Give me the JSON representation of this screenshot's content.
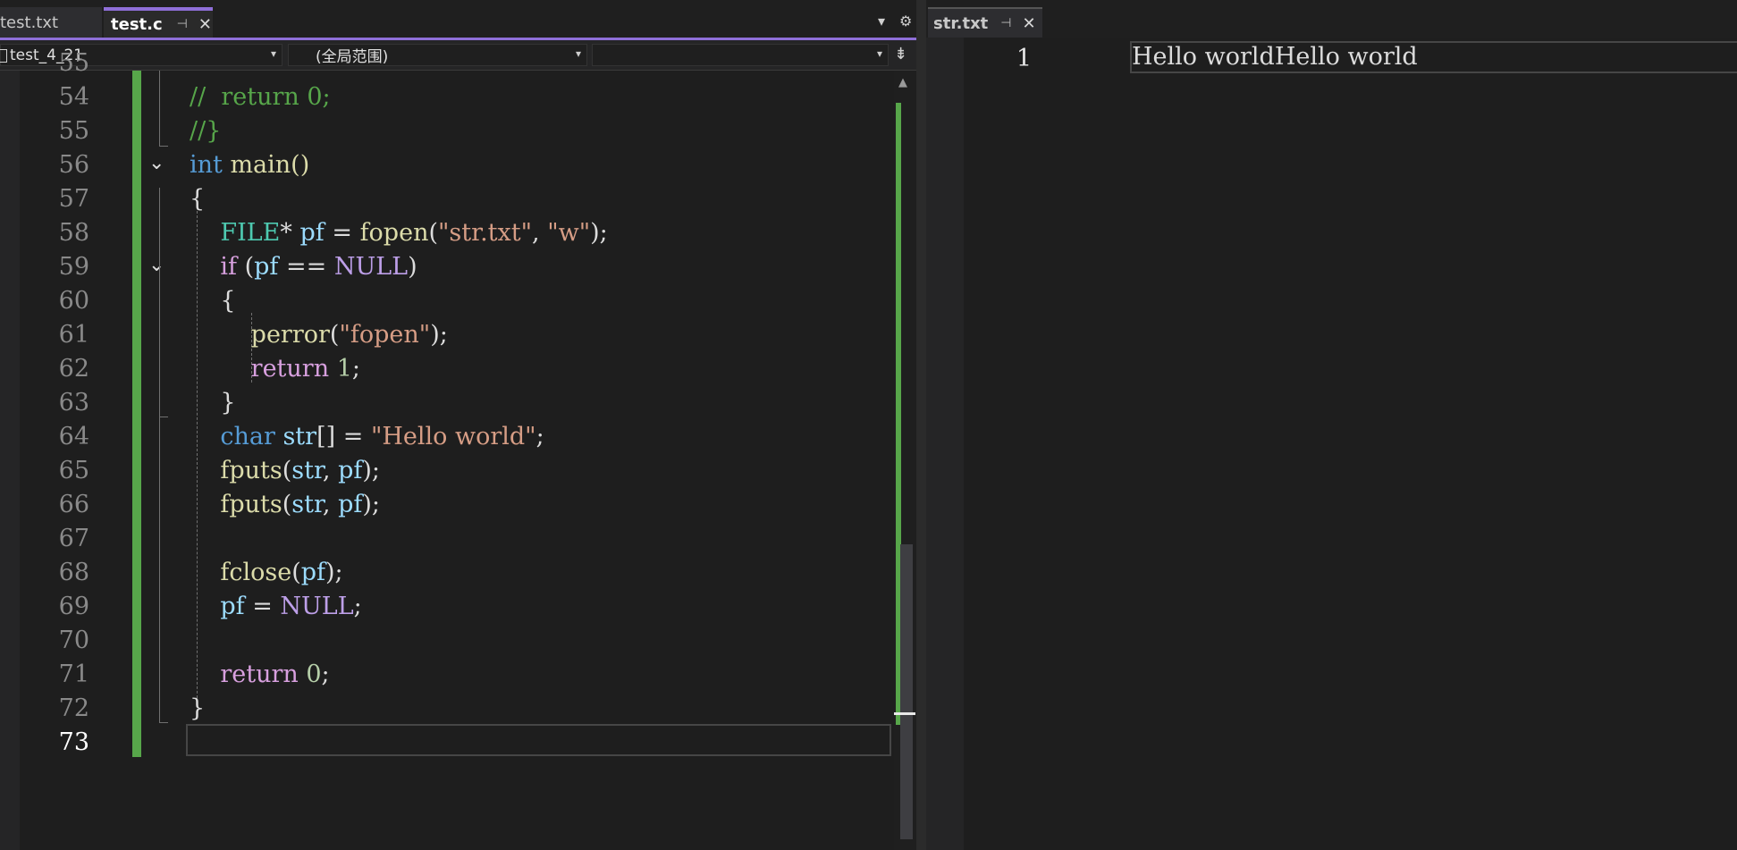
{
  "left_editor": {
    "tabs": [
      {
        "label": "test.txt",
        "active": false
      },
      {
        "label": "test.c",
        "active": true
      }
    ],
    "tab_pin_glyph": "⊣",
    "tab_close_glyph": "✕",
    "nav": {
      "project": "test_4_21",
      "scope": "(全局范围)",
      "member": ""
    },
    "partial_top_line": "55",
    "line_numbers": [
      "54",
      "55",
      "56",
      "57",
      "58",
      "59",
      "60",
      "61",
      "62",
      "63",
      "64",
      "65",
      "66",
      "67",
      "68",
      "69",
      "70",
      "71",
      "72",
      "73"
    ],
    "current_line": "73"
  },
  "right_editor": {
    "tab": {
      "label": "str.txt"
    },
    "line_number": "1",
    "content": "Hello worldHello world"
  },
  "colors": {
    "accent": "#8f6fd8",
    "change_bar": "#57a64a",
    "comment": "#57a64a",
    "keyword": "#569cd6",
    "control": "#d8a0df",
    "function": "#dcdcaa",
    "type": "#4ec9b0",
    "string": "#d69d85",
    "macro": "#bd9fe8",
    "variable": "#9cdcfe",
    "number": "#b5cea8"
  },
  "code_lines": [
    [
      {
        "t": "//  return 0;",
        "c": "comment"
      }
    ],
    [
      {
        "t": "//}",
        "c": "comment"
      }
    ],
    [
      {
        "t": "int",
        "c": "kw"
      },
      {
        "t": " main()",
        "c": "func"
      }
    ],
    [
      {
        "t": "{",
        "c": "punc"
      }
    ],
    [
      {
        "t": "    ",
        "c": "punc"
      },
      {
        "t": "FILE",
        "c": "type"
      },
      {
        "t": "* ",
        "c": "punc"
      },
      {
        "t": "pf",
        "c": "var"
      },
      {
        "t": " = ",
        "c": "punc"
      },
      {
        "t": "fopen",
        "c": "func"
      },
      {
        "t": "(",
        "c": "punc"
      },
      {
        "t": "\"str.txt\"",
        "c": "str"
      },
      {
        "t": ", ",
        "c": "punc"
      },
      {
        "t": "\"w\"",
        "c": "str"
      },
      {
        "t": ");",
        "c": "punc"
      }
    ],
    [
      {
        "t": "    ",
        "c": "punc"
      },
      {
        "t": "if",
        "c": "ctrl"
      },
      {
        "t": " (",
        "c": "punc"
      },
      {
        "t": "pf",
        "c": "var"
      },
      {
        "t": " == ",
        "c": "punc"
      },
      {
        "t": "NULL",
        "c": "macro"
      },
      {
        "t": ")",
        "c": "punc"
      }
    ],
    [
      {
        "t": "    {",
        "c": "punc"
      }
    ],
    [
      {
        "t": "        ",
        "c": "punc"
      },
      {
        "t": "perror",
        "c": "func"
      },
      {
        "t": "(",
        "c": "punc"
      },
      {
        "t": "\"fopen\"",
        "c": "str"
      },
      {
        "t": ");",
        "c": "punc"
      }
    ],
    [
      {
        "t": "        ",
        "c": "punc"
      },
      {
        "t": "return",
        "c": "ctrl"
      },
      {
        "t": " ",
        "c": "punc"
      },
      {
        "t": "1",
        "c": "num"
      },
      {
        "t": ";",
        "c": "punc"
      }
    ],
    [
      {
        "t": "    }",
        "c": "punc"
      }
    ],
    [
      {
        "t": "    ",
        "c": "punc"
      },
      {
        "t": "char",
        "c": "kw"
      },
      {
        "t": " ",
        "c": "punc"
      },
      {
        "t": "str",
        "c": "var"
      },
      {
        "t": "[] = ",
        "c": "punc"
      },
      {
        "t": "\"Hello world\"",
        "c": "str"
      },
      {
        "t": ";",
        "c": "punc"
      }
    ],
    [
      {
        "t": "    ",
        "c": "punc"
      },
      {
        "t": "fputs",
        "c": "func"
      },
      {
        "t": "(",
        "c": "punc"
      },
      {
        "t": "str",
        "c": "var"
      },
      {
        "t": ", ",
        "c": "punc"
      },
      {
        "t": "pf",
        "c": "var"
      },
      {
        "t": ");",
        "c": "punc"
      }
    ],
    [
      {
        "t": "    ",
        "c": "punc"
      },
      {
        "t": "fputs",
        "c": "func"
      },
      {
        "t": "(",
        "c": "punc"
      },
      {
        "t": "str",
        "c": "var"
      },
      {
        "t": ", ",
        "c": "punc"
      },
      {
        "t": "pf",
        "c": "var"
      },
      {
        "t": ");",
        "c": "punc"
      }
    ],
    [],
    [
      {
        "t": "    ",
        "c": "punc"
      },
      {
        "t": "fclose",
        "c": "func"
      },
      {
        "t": "(",
        "c": "punc"
      },
      {
        "t": "pf",
        "c": "var"
      },
      {
        "t": ");",
        "c": "punc"
      }
    ],
    [
      {
        "t": "    ",
        "c": "punc"
      },
      {
        "t": "pf",
        "c": "var"
      },
      {
        "t": " = ",
        "c": "punc"
      },
      {
        "t": "NULL",
        "c": "macro"
      },
      {
        "t": ";",
        "c": "punc"
      }
    ],
    [],
    [
      {
        "t": "    ",
        "c": "punc"
      },
      {
        "t": "return",
        "c": "ctrl"
      },
      {
        "t": " ",
        "c": "punc"
      },
      {
        "t": "0",
        "c": "num"
      },
      {
        "t": ";",
        "c": "punc"
      }
    ],
    [
      {
        "t": "}",
        "c": "punc"
      }
    ],
    []
  ]
}
